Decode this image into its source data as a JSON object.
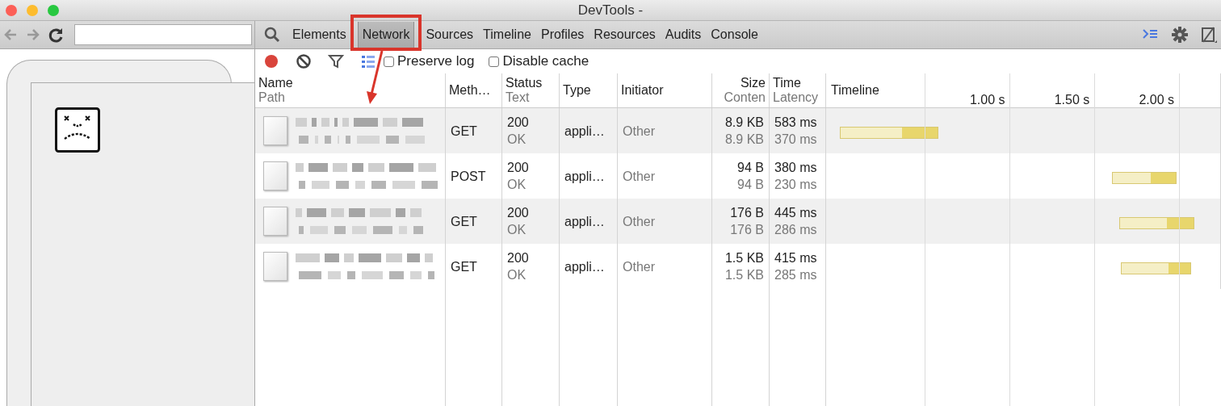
{
  "window": {
    "title": "DevTools -"
  },
  "tabs": [
    {
      "label": "Elements",
      "selected": false
    },
    {
      "label": "Network",
      "selected": true
    },
    {
      "label": "Sources",
      "selected": false
    },
    {
      "label": "Timeline",
      "selected": false
    },
    {
      "label": "Profiles",
      "selected": false
    },
    {
      "label": "Resources",
      "selected": false
    },
    {
      "label": "Audits",
      "selected": false
    },
    {
      "label": "Console",
      "selected": false
    }
  ],
  "network_toolbar": {
    "recording": true,
    "options": [
      {
        "label": "Preserve log",
        "checked": false
      },
      {
        "label": "Disable cache",
        "checked": false
      }
    ]
  },
  "table": {
    "columns": [
      {
        "label": "Name",
        "sublabel": "Path"
      },
      {
        "label": "Meth…"
      },
      {
        "label": "Status",
        "sublabel": "Text"
      },
      {
        "label": "Type"
      },
      {
        "label": "Initiator"
      },
      {
        "label": "Size",
        "sublabel": "Conten"
      },
      {
        "label": "Time",
        "sublabel": "Latency"
      }
    ],
    "rows": [
      {
        "method": "GET",
        "status": "200",
        "status_text": "OK",
        "type": "appli…",
        "initiator": "Other",
        "size": "8.9 KB",
        "content": "8.9 KB",
        "time": "583 ms",
        "latency": "370 ms"
      },
      {
        "method": "POST",
        "status": "200",
        "status_text": "OK",
        "type": "appli…",
        "initiator": "Other",
        "size": "94 B",
        "content": "94 B",
        "time": "380 ms",
        "latency": "230 ms"
      },
      {
        "method": "GET",
        "status": "200",
        "status_text": "OK",
        "type": "appli…",
        "initiator": "Other",
        "size": "176 B",
        "content": "176 B",
        "time": "445 ms",
        "latency": "286 ms"
      },
      {
        "method": "GET",
        "status": "200",
        "status_text": "OK",
        "type": "appli…",
        "initiator": "Other",
        "size": "1.5 KB",
        "content": "1.5 KB",
        "time": "415 ms",
        "latency": "285 ms"
      }
    ]
  },
  "timeline": {
    "label": "Timeline",
    "ticks": [
      "1.00 s",
      "1.50 s",
      "2.00 s"
    ]
  }
}
